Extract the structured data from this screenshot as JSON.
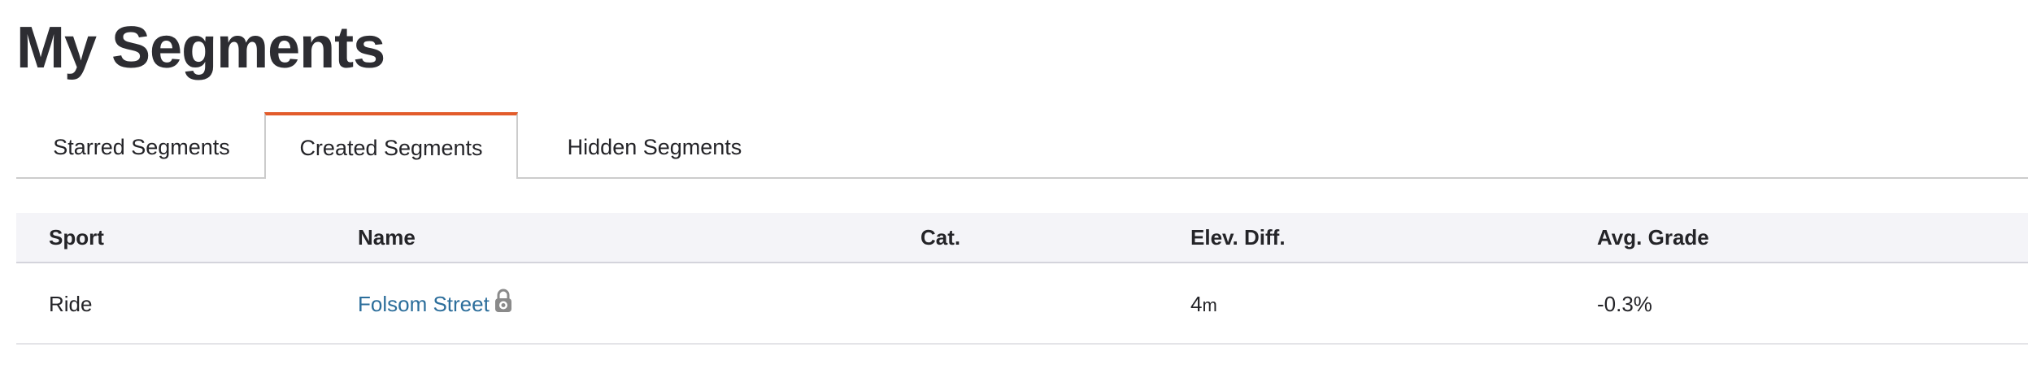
{
  "page": {
    "title": "My Segments"
  },
  "tabs": [
    {
      "label": "Starred Segments",
      "active": false
    },
    {
      "label": "Created Segments",
      "active": true
    },
    {
      "label": "Hidden Segments",
      "active": false
    }
  ],
  "table": {
    "columns": [
      "Sport",
      "Name",
      "Cat.",
      "Elev. Diff.",
      "Avg. Grade"
    ],
    "rows": [
      {
        "sport": "Ride",
        "name": "Folsom Street",
        "name_icon": "lock-icon",
        "cat": "",
        "elev_value": "4",
        "elev_unit": "m",
        "avg_grade": "-0.3%"
      }
    ]
  },
  "colors": {
    "accent": "#e35c2b",
    "link": "#2c6e9b",
    "header_bg": "#f4f4f8"
  }
}
